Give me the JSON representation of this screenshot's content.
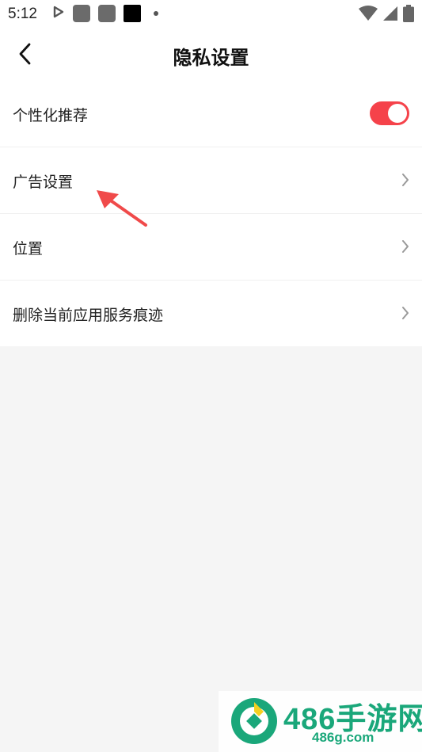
{
  "status_bar": {
    "time": "5:12",
    "icons_left": [
      "play-store-icon",
      "app-notification-icon",
      "app-notification-icon",
      "app-notification-icon",
      "more-dot-icon"
    ],
    "icons_right": [
      "wifi-icon",
      "cellular-signal-icon",
      "battery-icon"
    ]
  },
  "header": {
    "back_icon": "chevron-left-icon",
    "title": "隐私设置"
  },
  "settings": {
    "items": [
      {
        "label": "个性化推荐",
        "control": "toggle",
        "toggle_on": true
      },
      {
        "label": "广告设置",
        "control": "chevron"
      },
      {
        "label": "位置",
        "control": "chevron"
      },
      {
        "label": "删除当前应用服务痕迹",
        "control": "chevron"
      }
    ]
  },
  "annotation": {
    "icon": "red-arrow-icon",
    "color": "#f04a4a"
  },
  "watermark": {
    "title": "486手游网",
    "url": "486g.com",
    "color": "#1aa77a"
  },
  "colors": {
    "accent": "#f5424a",
    "background": "#f5f5f5",
    "surface": "#ffffff"
  }
}
